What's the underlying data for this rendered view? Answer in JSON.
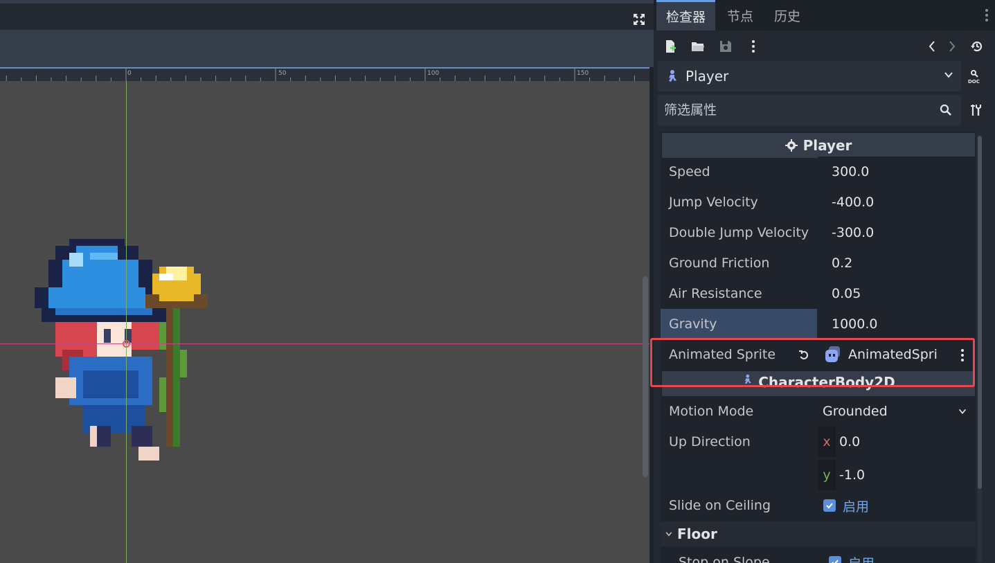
{
  "viewport": {
    "ruler_labels": [
      "0",
      "50",
      "100",
      "150"
    ]
  },
  "dock": {
    "tabs": [
      "检查器",
      "节点",
      "历史"
    ],
    "active_tab": 0
  },
  "inspector": {
    "object_name": "Player",
    "filter_placeholder": "筛选属性",
    "section_player": "Player",
    "section_body": "CharacterBody2D",
    "properties": [
      {
        "label": "Speed",
        "value": "300.0"
      },
      {
        "label": "Jump Velocity",
        "value": "-400.0"
      },
      {
        "label": "Double Jump Velocity",
        "value": "-300.0"
      },
      {
        "label": "Ground Friction",
        "value": "0.2"
      },
      {
        "label": "Air Resistance",
        "value": "0.05"
      },
      {
        "label": "Gravity",
        "value": "1000.0"
      }
    ],
    "animated_sprite": {
      "label": "Animated Sprite",
      "value": "AnimatedSpri"
    },
    "motion_mode": {
      "label": "Motion Mode",
      "value": "Grounded"
    },
    "up_direction": {
      "label": "Up Direction",
      "x_tag": "x",
      "x": "0.0",
      "y_tag": "y",
      "y": "-1.0"
    },
    "slide_on_ceiling": {
      "label": "Slide on Ceiling",
      "value": "启用"
    },
    "floor_group": "Floor",
    "stop_on_slope": {
      "label": "Stop on Slope",
      "value": "启用"
    }
  },
  "colors": {
    "accent": "#6d9be0",
    "highlight_row": "#384a66",
    "annotation": "#e5484d",
    "x_axis": "#c0487f",
    "y_axis": "#7bb05a"
  }
}
